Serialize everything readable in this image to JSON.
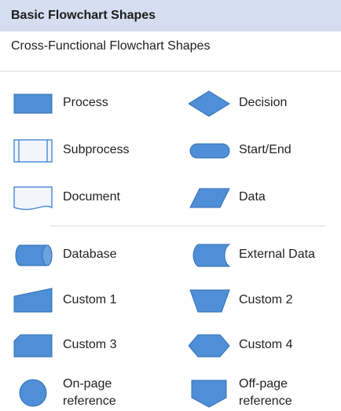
{
  "panel": {
    "title": "Basic Flowchart Shapes",
    "subtitle": "Cross-Functional Flowchart Shapes"
  },
  "colors": {
    "shape_fill": "#4f8fd7",
    "shape_stroke": "#2f6fb6",
    "header_bg": "#d5def0"
  },
  "shapes": {
    "process": "Process",
    "decision": "Decision",
    "subprocess": "Subprocess",
    "start_end": "Start/End",
    "document": "Document",
    "data": "Data",
    "database": "Database",
    "external_data": "External Data",
    "custom1": "Custom 1",
    "custom2": "Custom 2",
    "custom3": "Custom 3",
    "custom4": "Custom 4",
    "onpage_line1": "On-page",
    "onpage_line2": "reference",
    "offpage_line1": "Off-page",
    "offpage_line2": "reference"
  }
}
